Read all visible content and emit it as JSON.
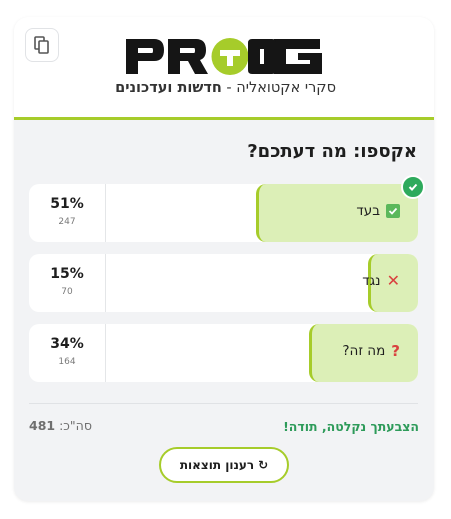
{
  "header": {
    "brand": "PROG",
    "tagline_main": "סקרי אקטואליה - ",
    "tagline_bold": "חדשות ועדכונים"
  },
  "poll": {
    "question": "אקספו: מה דעתכם?",
    "options": [
      {
        "label": "בעד",
        "percent_text": "51%",
        "percent": 51,
        "count": "247",
        "icon": "check-box-icon",
        "selected": true
      },
      {
        "label": "נגד",
        "percent_text": "15%",
        "percent": 15,
        "count": "70",
        "icon": "x-mark-icon",
        "selected": false
      },
      {
        "label": "מה זה?",
        "percent_text": "34%",
        "percent": 34,
        "count": "164",
        "icon": "question-mark-icon",
        "selected": false
      }
    ]
  },
  "footer": {
    "thanks": "הצבעתך נקלטה, תודה!",
    "total_label": "סה\"כ:",
    "total_value": "481",
    "refresh_label": "רענון תוצאות",
    "refresh_icon": "↻"
  },
  "colors": {
    "accent": "#a6cc2a",
    "fill": "#dcefb7",
    "success": "#2eaa5c",
    "danger": "#d9413f"
  }
}
